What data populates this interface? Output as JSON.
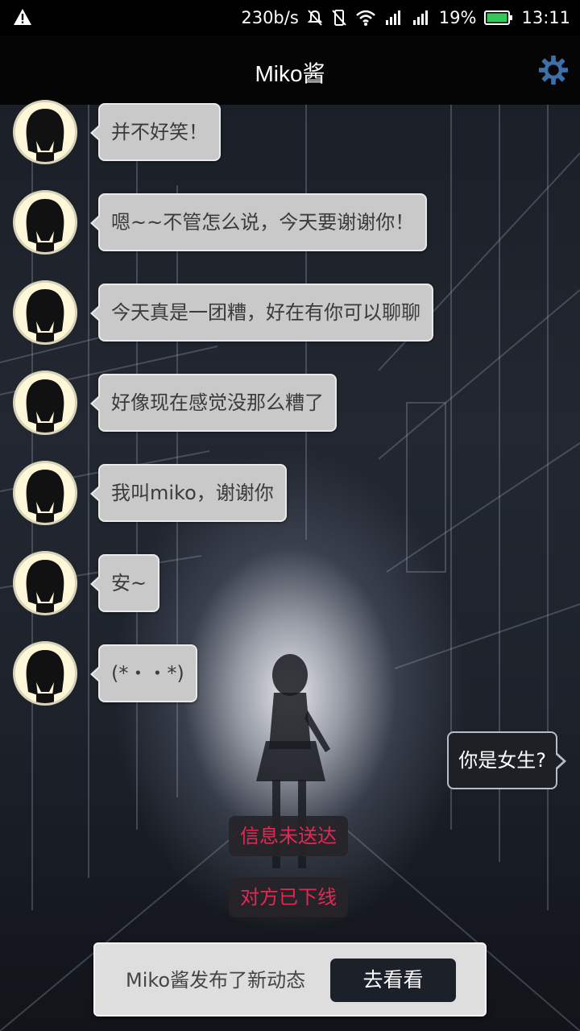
{
  "status_bar": {
    "speed": "230b/s",
    "battery": "19%",
    "time": "13:11",
    "icons": [
      "warning-icon",
      "mute-icon",
      "vibrate-icon",
      "wifi-icon",
      "signal-icon",
      "signal-icon",
      "battery-icon"
    ],
    "battery_color": "#34c759"
  },
  "header": {
    "title": "Miko酱",
    "settings_icon": "gear-icon",
    "gear_color": "#3d6fa8"
  },
  "messages": [
    {
      "from": "miko",
      "text": "并不好笑！"
    },
    {
      "from": "miko",
      "text": "嗯~~不管怎么说，今天要谢谢你！"
    },
    {
      "from": "miko",
      "text": "今天真是一团糟，好在有你可以聊聊"
    },
    {
      "from": "miko",
      "text": "好像现在感觉没那么糟了"
    },
    {
      "from": "miko",
      "text": "我叫miko，谢谢你"
    },
    {
      "from": "miko",
      "text": "安~"
    },
    {
      "from": "miko",
      "text": "(*・・*)"
    }
  ],
  "my_message": {
    "text": "你是女生?"
  },
  "system_messages": [
    {
      "text": "信息未送达"
    },
    {
      "text": "对方已下线"
    }
  ],
  "system_color": "#e02a55",
  "notification": {
    "text": "Miko酱发布了新动态",
    "button_label": "去看看"
  }
}
